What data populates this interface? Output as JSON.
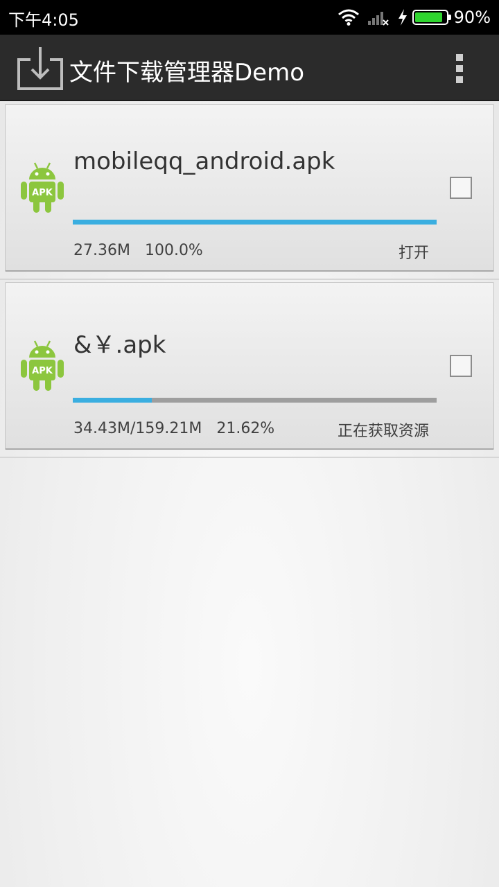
{
  "status_bar": {
    "time": "下午4:05",
    "battery_percent": "90%",
    "battery_level": 0.9,
    "icons": [
      "wifi-icon",
      "signal-icon",
      "charging-icon",
      "battery-icon"
    ]
  },
  "action_bar": {
    "title": "文件下载管理器Demo",
    "app_icon": "download-icon",
    "overflow_icon": "overflow-menu-icon"
  },
  "downloads": [
    {
      "name": "mobileqq_android.apk",
      "size": "27.36M",
      "percent": "100.0%",
      "progress": 1.0,
      "action": "打开",
      "icon": "android-apk-icon",
      "checked": false
    },
    {
      "name": "&￥.apk",
      "size": "34.43M/159.21M",
      "percent": "21.62%",
      "progress": 0.2162,
      "action": "正在获取资源",
      "icon": "android-apk-icon",
      "checked": false
    }
  ],
  "colors": {
    "progress": "#3aaee0",
    "track": "#9e9e9e",
    "battery": "#2fd52f",
    "android_green": "#8cc63e",
    "action_bar": "#2b2b2b"
  }
}
